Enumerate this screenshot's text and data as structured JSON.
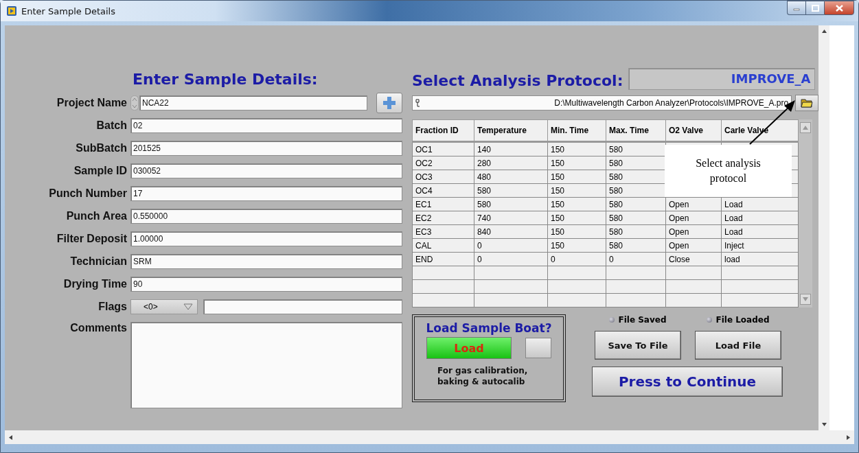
{
  "window": {
    "title": "Enter Sample Details"
  },
  "sample_details": {
    "heading": "Enter Sample Details:",
    "fields": [
      {
        "kind": "text",
        "label": "Project Name",
        "value": "NCA22",
        "spinner": true,
        "add_button": true
      },
      {
        "kind": "text",
        "label": "Batch",
        "value": "02"
      },
      {
        "kind": "text",
        "label": "SubBatch",
        "value": "201525"
      },
      {
        "kind": "text",
        "label": "Sample ID",
        "value": "030052"
      },
      {
        "kind": "text",
        "label": "Punch Number",
        "value": "17"
      },
      {
        "kind": "text",
        "label": "Punch Area",
        "value": "0.550000"
      },
      {
        "kind": "text",
        "label": "Filter Deposit",
        "value": "1.00000"
      },
      {
        "kind": "text",
        "label": "Technician",
        "value": "SRM"
      },
      {
        "kind": "text",
        "label": "Drying Time",
        "value": "90"
      },
      {
        "kind": "flags",
        "label": "Flags",
        "value": "<0>"
      },
      {
        "kind": "comments",
        "label": "Comments"
      }
    ]
  },
  "protocol": {
    "heading": "Select Analysis Protocol:",
    "name": "IMPROVE_A",
    "path": "D:\\Multiwavelength Carbon Analyzer\\Protocols\\IMPROVE_A.pro",
    "table": {
      "columns": [
        "Fraction ID",
        "Temperature",
        "Min. Time",
        "Max. Time",
        "O2 Valve",
        "Carle Valve"
      ],
      "rows": [
        {
          "cells": [
            "OC1",
            "140",
            "150",
            "580"
          ]
        },
        {
          "cells": [
            "OC2",
            "280",
            "150",
            "580"
          ]
        },
        {
          "cells": [
            "OC3",
            "480",
            "150",
            "580"
          ]
        },
        {
          "cells": [
            "OC4",
            "580",
            "150",
            "580"
          ]
        },
        {
          "cells": [
            "EC1",
            "580",
            "150",
            "580",
            "Open",
            "Load"
          ]
        },
        {
          "cells": [
            "EC2",
            "740",
            "150",
            "580",
            "Open",
            "Load"
          ]
        },
        {
          "cells": [
            "EC3",
            "840",
            "150",
            "580",
            "Open",
            "Load"
          ]
        },
        {
          "cells": [
            "CAL",
            "0",
            "150",
            "580",
            "Open",
            "Inject"
          ]
        },
        {
          "cells": [
            "END",
            "0",
            "0",
            "0",
            "Close",
            "load"
          ]
        }
      ]
    },
    "callout": "Select analysis protocol"
  },
  "load_boat": {
    "title": "Load Sample Boat?",
    "button": "Load",
    "on": true,
    "switch_on": false,
    "note": "For gas calibration, baking & autocalib"
  },
  "file_status": [
    {
      "label": "File Saved",
      "on": false,
      "button": "Save To File"
    },
    {
      "label": "File Loaded",
      "on": false,
      "button": "Load File"
    }
  ],
  "continue_button": "Press to Continue"
}
